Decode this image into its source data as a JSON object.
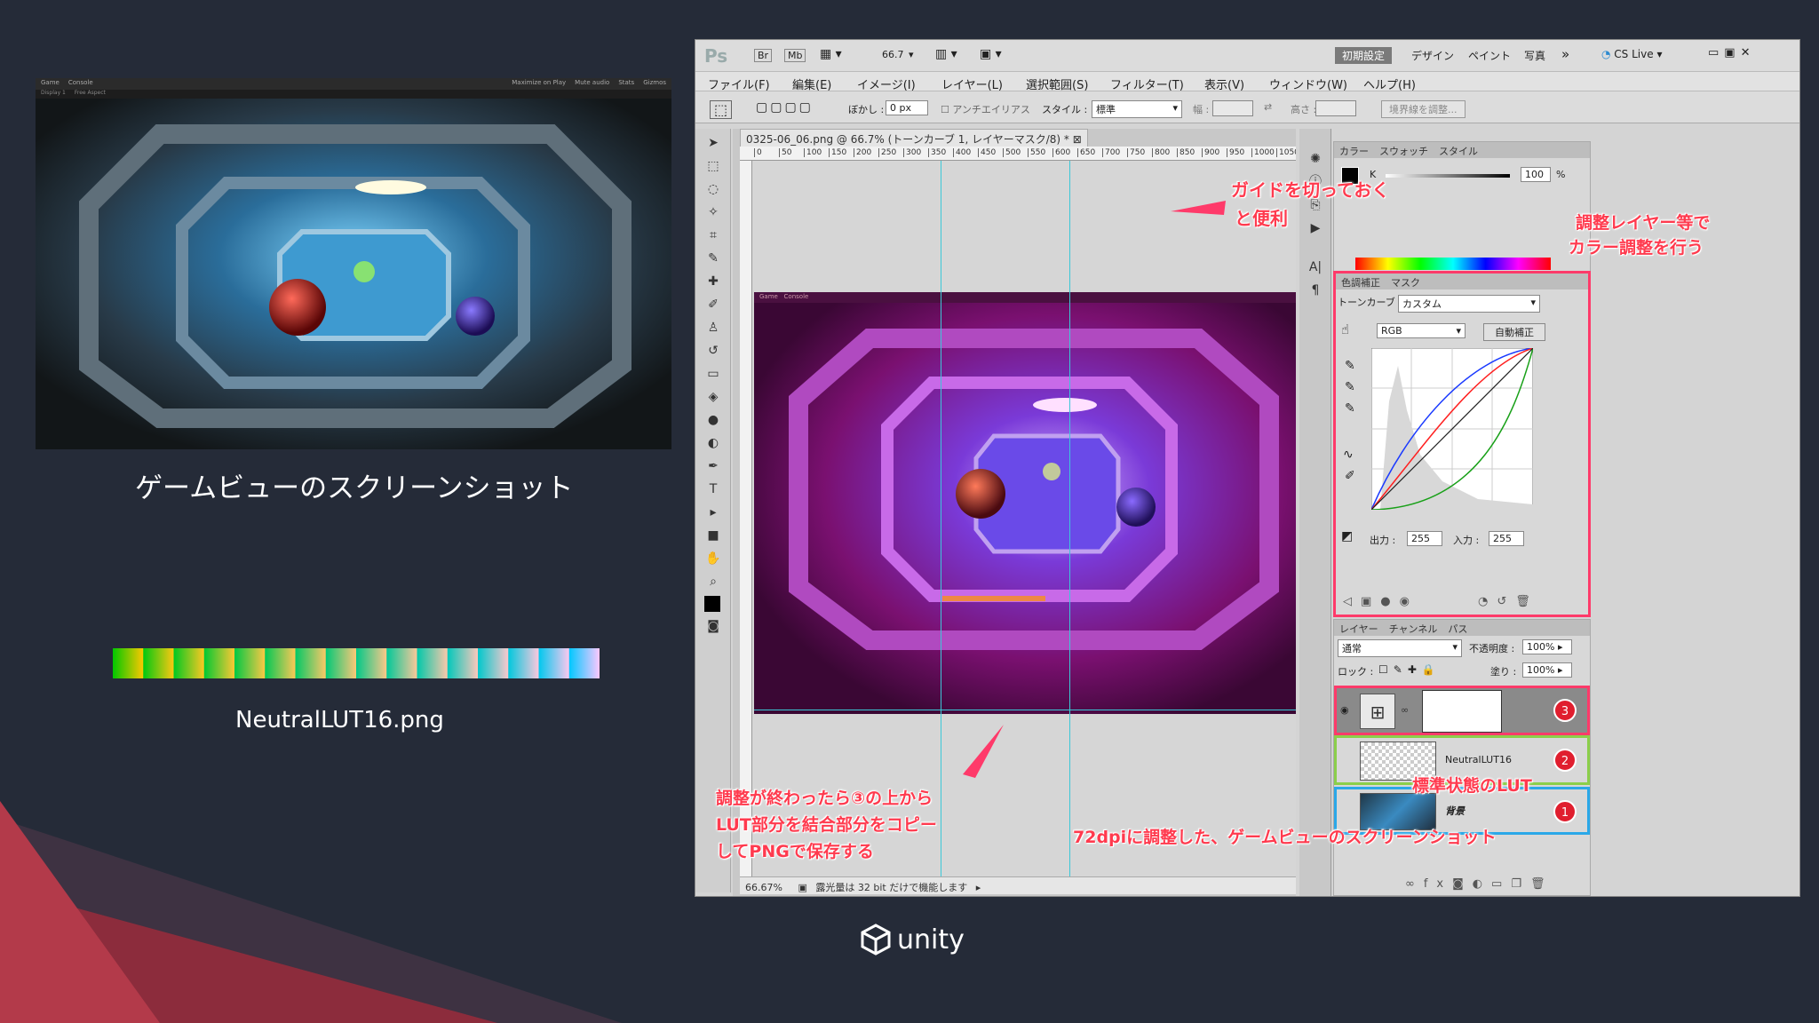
{
  "left": {
    "game_shot": {
      "tabs": [
        "Game",
        "Console"
      ],
      "sub": [
        "Display 1",
        "Free Aspect"
      ],
      "right": [
        "Maximize on Play",
        "Mute audio",
        "Stats",
        "Gizmos"
      ]
    },
    "caption_screenshot": "ゲームビューのスクリーンショット",
    "caption_lut": "NeutralLUT16.png"
  },
  "logo": {
    "text": "unity"
  },
  "ps": {
    "app_logo": "Ps",
    "top_buttons": [
      "Br",
      "Mb"
    ],
    "zoom": "66.7",
    "workspaces": [
      "初期設定",
      "デザイン",
      "ペイント",
      "写真"
    ],
    "more": "»",
    "cs_live": "CS Live",
    "menu": [
      "ファイル(F)",
      "編集(E)",
      "イメージ(I)",
      "レイヤー(L)",
      "選択範囲(S)",
      "フィルター(T)",
      "表示(V)",
      "ウィンドウ(W)",
      "ヘルプ(H)"
    ],
    "options": {
      "feather_label": "ぼかし :",
      "feather_value": "0 px",
      "antialias": "アンチエイリアス",
      "style_label": "スタイル :",
      "style_value": "標準",
      "width_label": "幅 :",
      "height_label": "高さ :",
      "refine": "境界線を調整..."
    },
    "doc_title": "0325-06_06.png @ 66.7% (トーンカーブ 1, レイヤーマスク/8) *",
    "ruler_ticks": [
      "0",
      "50",
      "100",
      "150",
      "200",
      "250",
      "300",
      "350",
      "400",
      "450",
      "500",
      "550",
      "600",
      "650",
      "700",
      "750",
      "800",
      "850",
      "900",
      "950",
      "1000",
      "1050"
    ],
    "status_zoom": "66.67%",
    "status_text": "露光量は 32 bit だけで機能します",
    "color_panel": {
      "tabs": [
        "カラー",
        "スウォッチ",
        "スタイル"
      ],
      "k_label": "K",
      "k_value": "100",
      "unit": "%"
    },
    "adjust_panel": {
      "tabs": [
        "色調補正",
        "マスク"
      ],
      "tonecurve_label": "トーンカーブ",
      "preset": "カスタム",
      "channel": "RGB",
      "auto": "自動補正",
      "out_label": "出力 :",
      "out_value": "255",
      "in_label": "入力 :",
      "in_value": "255"
    },
    "layers_panel": {
      "tabs": [
        "レイヤー",
        "チャンネル",
        "パス"
      ],
      "blend": "通常",
      "opacity_label": "不透明度 :",
      "opacity": "100%",
      "lock_label": "ロック :",
      "fill_label": "塗り :",
      "fill": "100%",
      "layers": [
        {
          "name": "",
          "badge": "3"
        },
        {
          "name": "NeutralLUT16",
          "badge": "2"
        },
        {
          "name": "背景",
          "badge": "1"
        }
      ]
    }
  },
  "annotations": {
    "guide": [
      "ガイドを切っておく",
      "と便利"
    ],
    "adjust": [
      "調整レイヤー等で",
      "カラー調整を行う"
    ],
    "copy": [
      "調整が終わったら③の上から",
      "LUT部分を結合部分をコピー",
      "してPNGで保存する"
    ],
    "lut_state": "標準状態のLUT",
    "game_72dpi": "72dpiに調整した、ゲームビューのスクリーンショット"
  },
  "colors": {
    "accent_red": "#ff3a4e",
    "badge_red": "#e01e2e",
    "guide_cyan": "#3cc8d8",
    "bg": "#252b38"
  }
}
